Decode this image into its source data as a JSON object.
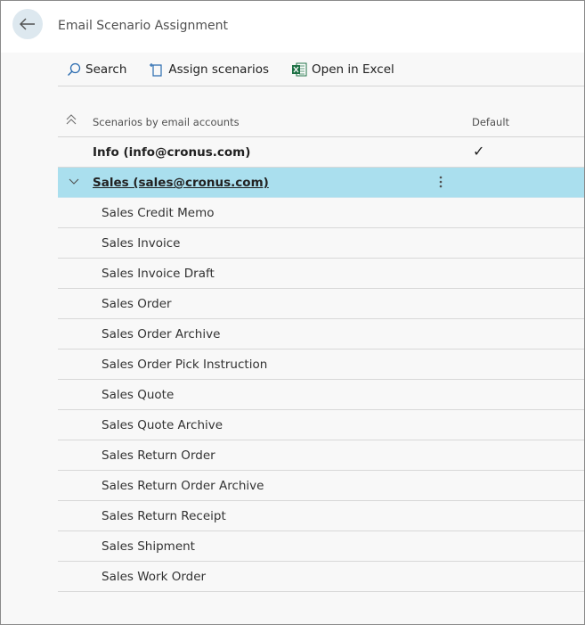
{
  "header": {
    "title": "Email Scenario Assignment",
    "back_icon": "arrow-left-icon"
  },
  "actions": {
    "search_label": "Search",
    "assign_label": "Assign scenarios",
    "excel_label": "Open in Excel"
  },
  "grid": {
    "col_scenarios": "Scenarios by email accounts",
    "col_default": "Default",
    "accounts": [
      {
        "label": "Info (info@cronus.com)",
        "default_mark": "✓"
      },
      {
        "label": "Sales (sales@cronus.com)",
        "default_mark": ""
      }
    ],
    "scenarios": [
      "Sales Credit Memo",
      "Sales Invoice",
      "Sales Invoice Draft",
      "Sales Order",
      "Sales Order Archive",
      "Sales Order Pick Instruction",
      "Sales Quote",
      "Sales Quote Archive",
      "Sales Return Order",
      "Sales Return Order Archive",
      "Sales Return Receipt",
      "Sales Shipment",
      "Sales Work Order"
    ]
  },
  "colors": {
    "selected_row": "#aadfee",
    "excel_green": "#1e7145",
    "accent_blue": "#2b6cb0"
  }
}
